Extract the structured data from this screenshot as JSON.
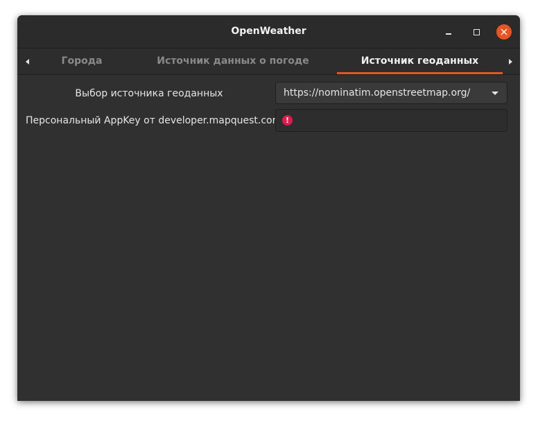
{
  "window": {
    "title": "OpenWeather"
  },
  "titlebar_buttons": {
    "minimize_icon": "minimize-icon",
    "maximize_icon": "maximize-icon",
    "close_icon": "close-icon",
    "close_symbol": "✕"
  },
  "tabs": {
    "items": [
      {
        "label": "Города",
        "active": false
      },
      {
        "label": "Источник данных о погоде",
        "active": false
      },
      {
        "label": "Источник геоданных",
        "active": true
      }
    ],
    "left_arrow_icon": "arrow-left-icon",
    "right_arrow_icon": "arrow-right-icon"
  },
  "settings": {
    "geo_provider_label": "Выбор источника геоданных",
    "geo_provider_value": "https://nominatim.openstreetmap.org/",
    "appkey_label": "Персональный AppKey от developer.mapquest.com",
    "appkey_value": "",
    "appkey_warning_icon": "warning-icon",
    "appkey_warning_symbol": "!"
  },
  "colors": {
    "accent": "#e95420",
    "window_bg": "#303030",
    "warning": "#e01b4f"
  }
}
